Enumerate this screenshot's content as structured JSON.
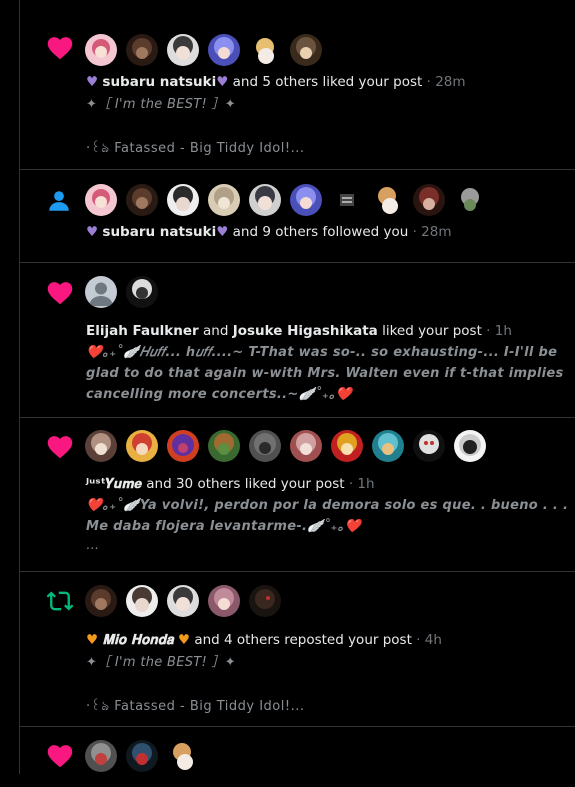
{
  "notifications": [
    {
      "kind": "like",
      "icon": "heart-icon",
      "avatars": [
        "#d45a78",
        "#5a3b2c",
        "#cfcfcf",
        "#6b6fd6",
        "#e6d8a8",
        "#6a5440"
      ],
      "actor_name": "subaru natsuki",
      "actor_prefix_emoji": "💜",
      "actor_suffix_emoji": "💜",
      "action": "and 5 others liked your post",
      "time": "· 28m",
      "quote": "✦［ I'm the BEST! ］✦",
      "sub": "·꒰ঌ Fatassed - Big Tiddy Idol!..."
    },
    {
      "kind": "follow",
      "icon": "person-icon",
      "avatars": [
        "#d45a78",
        "#5a3b2c",
        "#e8e8e8",
        "#c9b9a0",
        "#c8c8c8",
        "#6b6fd6",
        "#444444",
        "#d8a060",
        "#7a3028",
        "#9a9a9a"
      ],
      "actor_name": "subaru natsuki",
      "actor_prefix_emoji": "💜",
      "actor_suffix_emoji": "💜",
      "action": "and 9 others followed you",
      "time": "· 28m"
    },
    {
      "kind": "like",
      "icon": "heart-icon",
      "avatars": [
        "#a5acb4",
        "#dcdcdc"
      ],
      "actor_name": "Elijah Faulkner",
      "connector": "and",
      "actor_name_2": "Josuke Higashikata",
      "action": "liked your post",
      "time": "· 1h",
      "quote": "❤️｡₊˚🪽𝐻𝑢𝑓𝑓... ℎ𝑢𝑓𝑓....~ T-That was so-.. so exhausting-... I-I'll be glad to do that again w-with Mrs. Walten even if t-that implies cancelling more concerts..~🪽˚₊｡❤️"
    },
    {
      "kind": "like",
      "icon": "heart-icon",
      "avatars": [
        "#b09080",
        "#d04030",
        "#c04070",
        "#5a9040",
        "#707070",
        "#d0a0a0",
        "#e0a020",
        "#60c0d0",
        "#e0e0e0",
        "#cccccc"
      ],
      "actor_name": "ᴶᵘˢᵗ𝒀𝒖𝒎𝒆",
      "action": "and 30 others liked your post",
      "time": "· 1h",
      "quote": "❤️｡₊˚🪽Ya volvi!, perdon por la demora solo es que. . bueno . . . Me daba flojera levantarme-.🪽˚₊｡❤️",
      "more": "..."
    },
    {
      "kind": "repost",
      "icon": "repost-icon",
      "avatars": [
        "#5a3b2c",
        "#d8d8d8",
        "#cfcfcf",
        "#c08a9a",
        "#3a2820"
      ],
      "actor_name": "𝐌𝐢𝐨 𝐇𝐨𝐧𝐝𝐚",
      "actor_prefix_emoji": "🧡",
      "actor_suffix_emoji": "🧡",
      "action": "and 4 others reposted your post",
      "time": "· 4h",
      "quote": "✦［ I'm the BEST! ］✦",
      "sub": "·꒰ঌ Fatassed - Big Tiddy Idol!..."
    },
    {
      "kind": "like",
      "icon": "heart-icon",
      "avatars": [
        "#909090",
        "#305070",
        "#d8a060"
      ]
    }
  ],
  "colors": {
    "like": "#f91880",
    "follow": "#1d9bf0",
    "repost": "#00ba7c",
    "purple_heart": "#9b7fd4",
    "orange_heart": "#f29a1c"
  }
}
